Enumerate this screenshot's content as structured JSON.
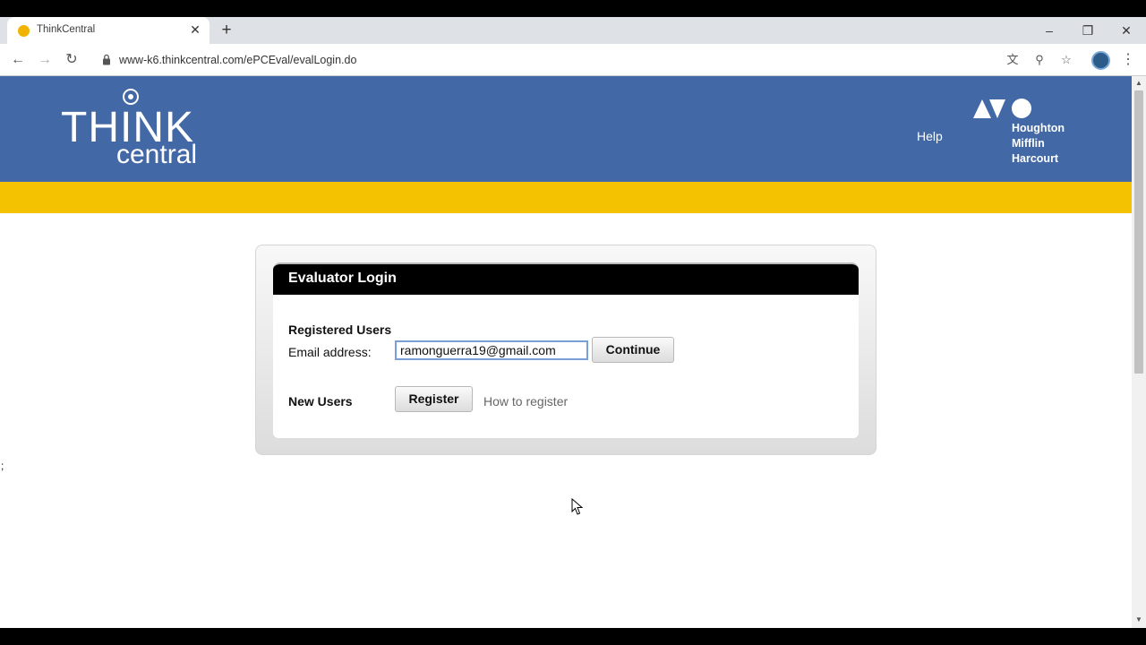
{
  "browser": {
    "tab_title": "ThinkCentral",
    "tab_close": "✕",
    "new_tab": "+",
    "url": "www-k6.thinkcentral.com/ePCEval/evalLogin.do"
  },
  "banner": {
    "logo_think": "THINK",
    "logo_central": "central",
    "help": "Help",
    "publisher_lines": [
      "Houghton",
      "Mifflin",
      "Harcourt"
    ]
  },
  "login": {
    "title": "Evaluator Login",
    "registered_label": "Registered Users",
    "email_label": "Email address:",
    "email_value": "ramonguerra19@gmail.com",
    "continue_label": "Continue",
    "new_users_label": "New Users",
    "register_label": "Register",
    "how_to_register": "How to register"
  },
  "stray_text": ";",
  "colors": {
    "banner": "#4268a6",
    "accent_bar": "#f5c200",
    "panel_header": "#000000"
  }
}
